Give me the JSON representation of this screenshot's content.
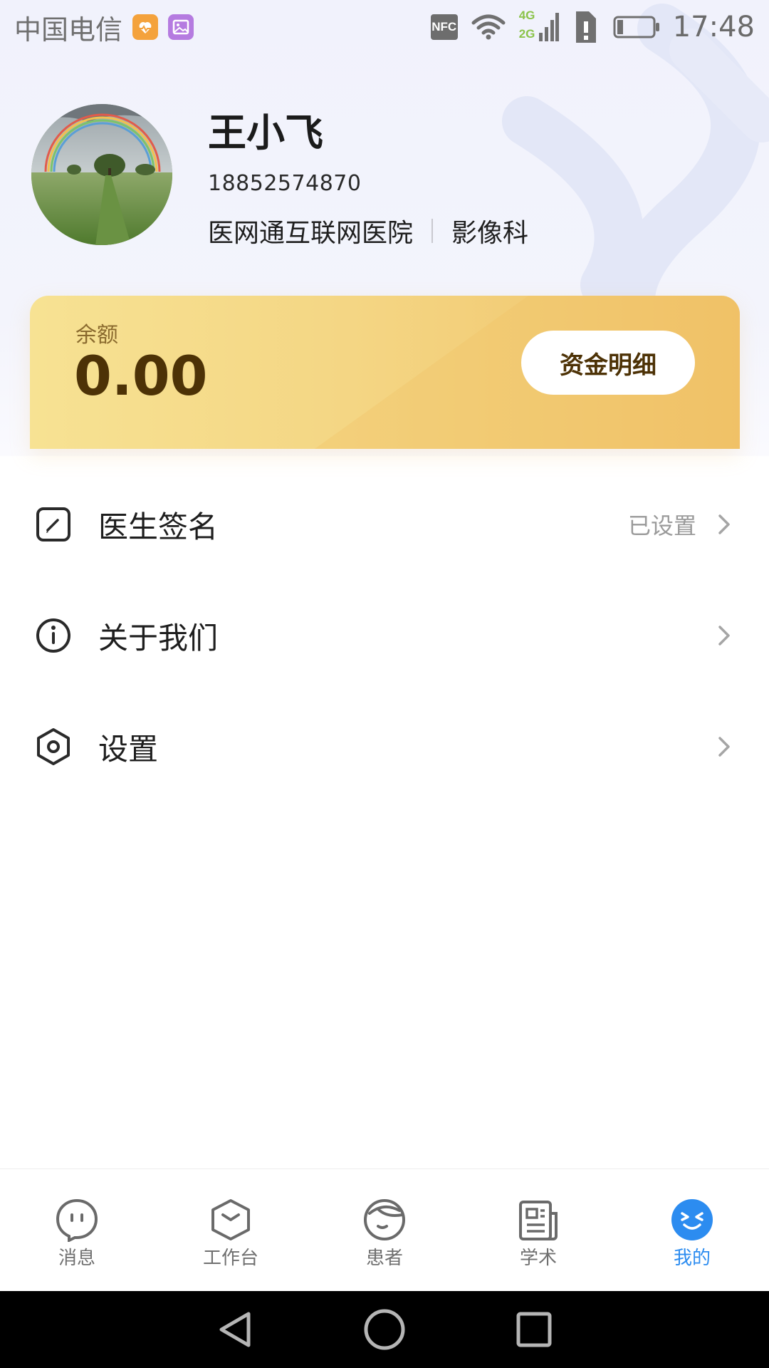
{
  "status_bar": {
    "carrier": "中国电信",
    "nfc": "NFC",
    "network_top": "4G",
    "network_bottom": "2G",
    "time": "17:48"
  },
  "profile": {
    "name": "王小飞",
    "phone": "18852574870",
    "hospital": "医网通互联网医院",
    "department": "影像科"
  },
  "balance": {
    "label": "余额",
    "value": "0.00",
    "detail_button": "资金明细"
  },
  "menu": [
    {
      "label": "医生签名",
      "value": "已设置",
      "icon": "signature-icon"
    },
    {
      "label": "关于我们",
      "value": "",
      "icon": "info-icon"
    },
    {
      "label": "设置",
      "value": "",
      "icon": "settings-hexagon-icon"
    }
  ],
  "bottom_nav": [
    {
      "label": "消息",
      "icon": "message-bubble-icon",
      "active": false
    },
    {
      "label": "工作台",
      "icon": "workbench-box-icon",
      "active": false
    },
    {
      "label": "患者",
      "icon": "patient-face-icon",
      "active": false
    },
    {
      "label": "学术",
      "icon": "academic-news-icon",
      "active": false
    },
    {
      "label": "我的",
      "icon": "my-profile-icon",
      "active": true
    }
  ],
  "colors": {
    "accent": "#2c8cf0",
    "card_gold_start": "#f7e293",
    "card_gold_end": "#f0c167",
    "balance_text": "#4d3206"
  }
}
